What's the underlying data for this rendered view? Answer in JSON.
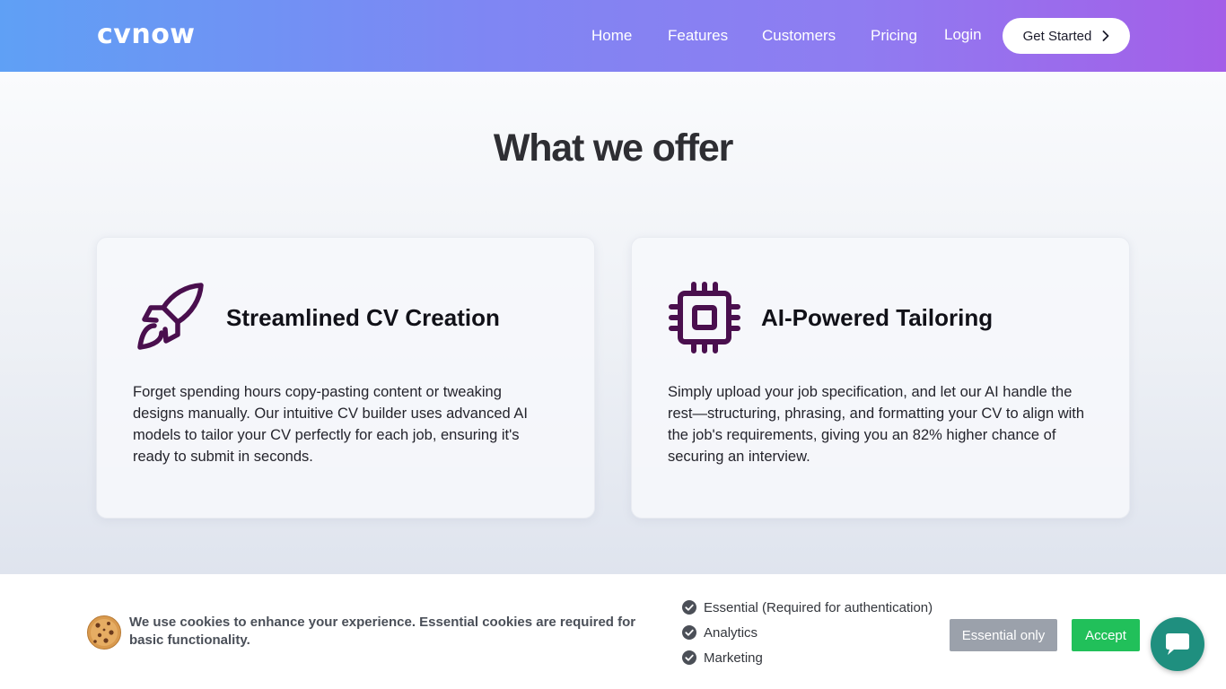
{
  "header": {
    "logo": "cvnow",
    "nav": [
      {
        "label": "Home"
      },
      {
        "label": "Features"
      },
      {
        "label": "Customers"
      },
      {
        "label": "Pricing"
      },
      {
        "label": "Login"
      }
    ],
    "cta_label": "Get Started",
    "cta_icon": "chevron-right-icon"
  },
  "main": {
    "title": "What we offer",
    "cards": [
      {
        "icon": "rocket-icon",
        "title": "Streamlined CV Creation",
        "text": "Forget spending hours copy-pasting content or tweaking designs manually. Our intuitive CV builder uses advanced AI models to tailor your CV perfectly for each job, ensuring it's ready to submit in seconds."
      },
      {
        "icon": "cpu-chip-icon",
        "title": "AI-Powered Tailoring",
        "text": "Simply upload your job specification, and let our AI handle the rest—structuring, phrasing, and formatting your CV to align with the job's requirements, giving you an 82% higher chance of securing an interview."
      }
    ],
    "icon_color": "#4a0f4e"
  },
  "cookie": {
    "icon": "cookie-icon",
    "message": "We use cookies to enhance your experience. Essential cookies are required for basic functionality.",
    "options": [
      {
        "label": "Essential (Required for authentication)",
        "checked": true
      },
      {
        "label": "Analytics",
        "checked": true
      },
      {
        "label": "Marketing",
        "checked": true
      }
    ],
    "essential_only_label": "Essential only",
    "accept_label": "Accept"
  },
  "chat": {
    "icon": "chat-bubble-icon",
    "color": "#1f8f7f"
  },
  "colors": {
    "accept": "#21c05a",
    "essential_only": "#9ba1ab",
    "header_gradient_start": "#5fa0f5",
    "header_gradient_end": "#a45ee8"
  }
}
